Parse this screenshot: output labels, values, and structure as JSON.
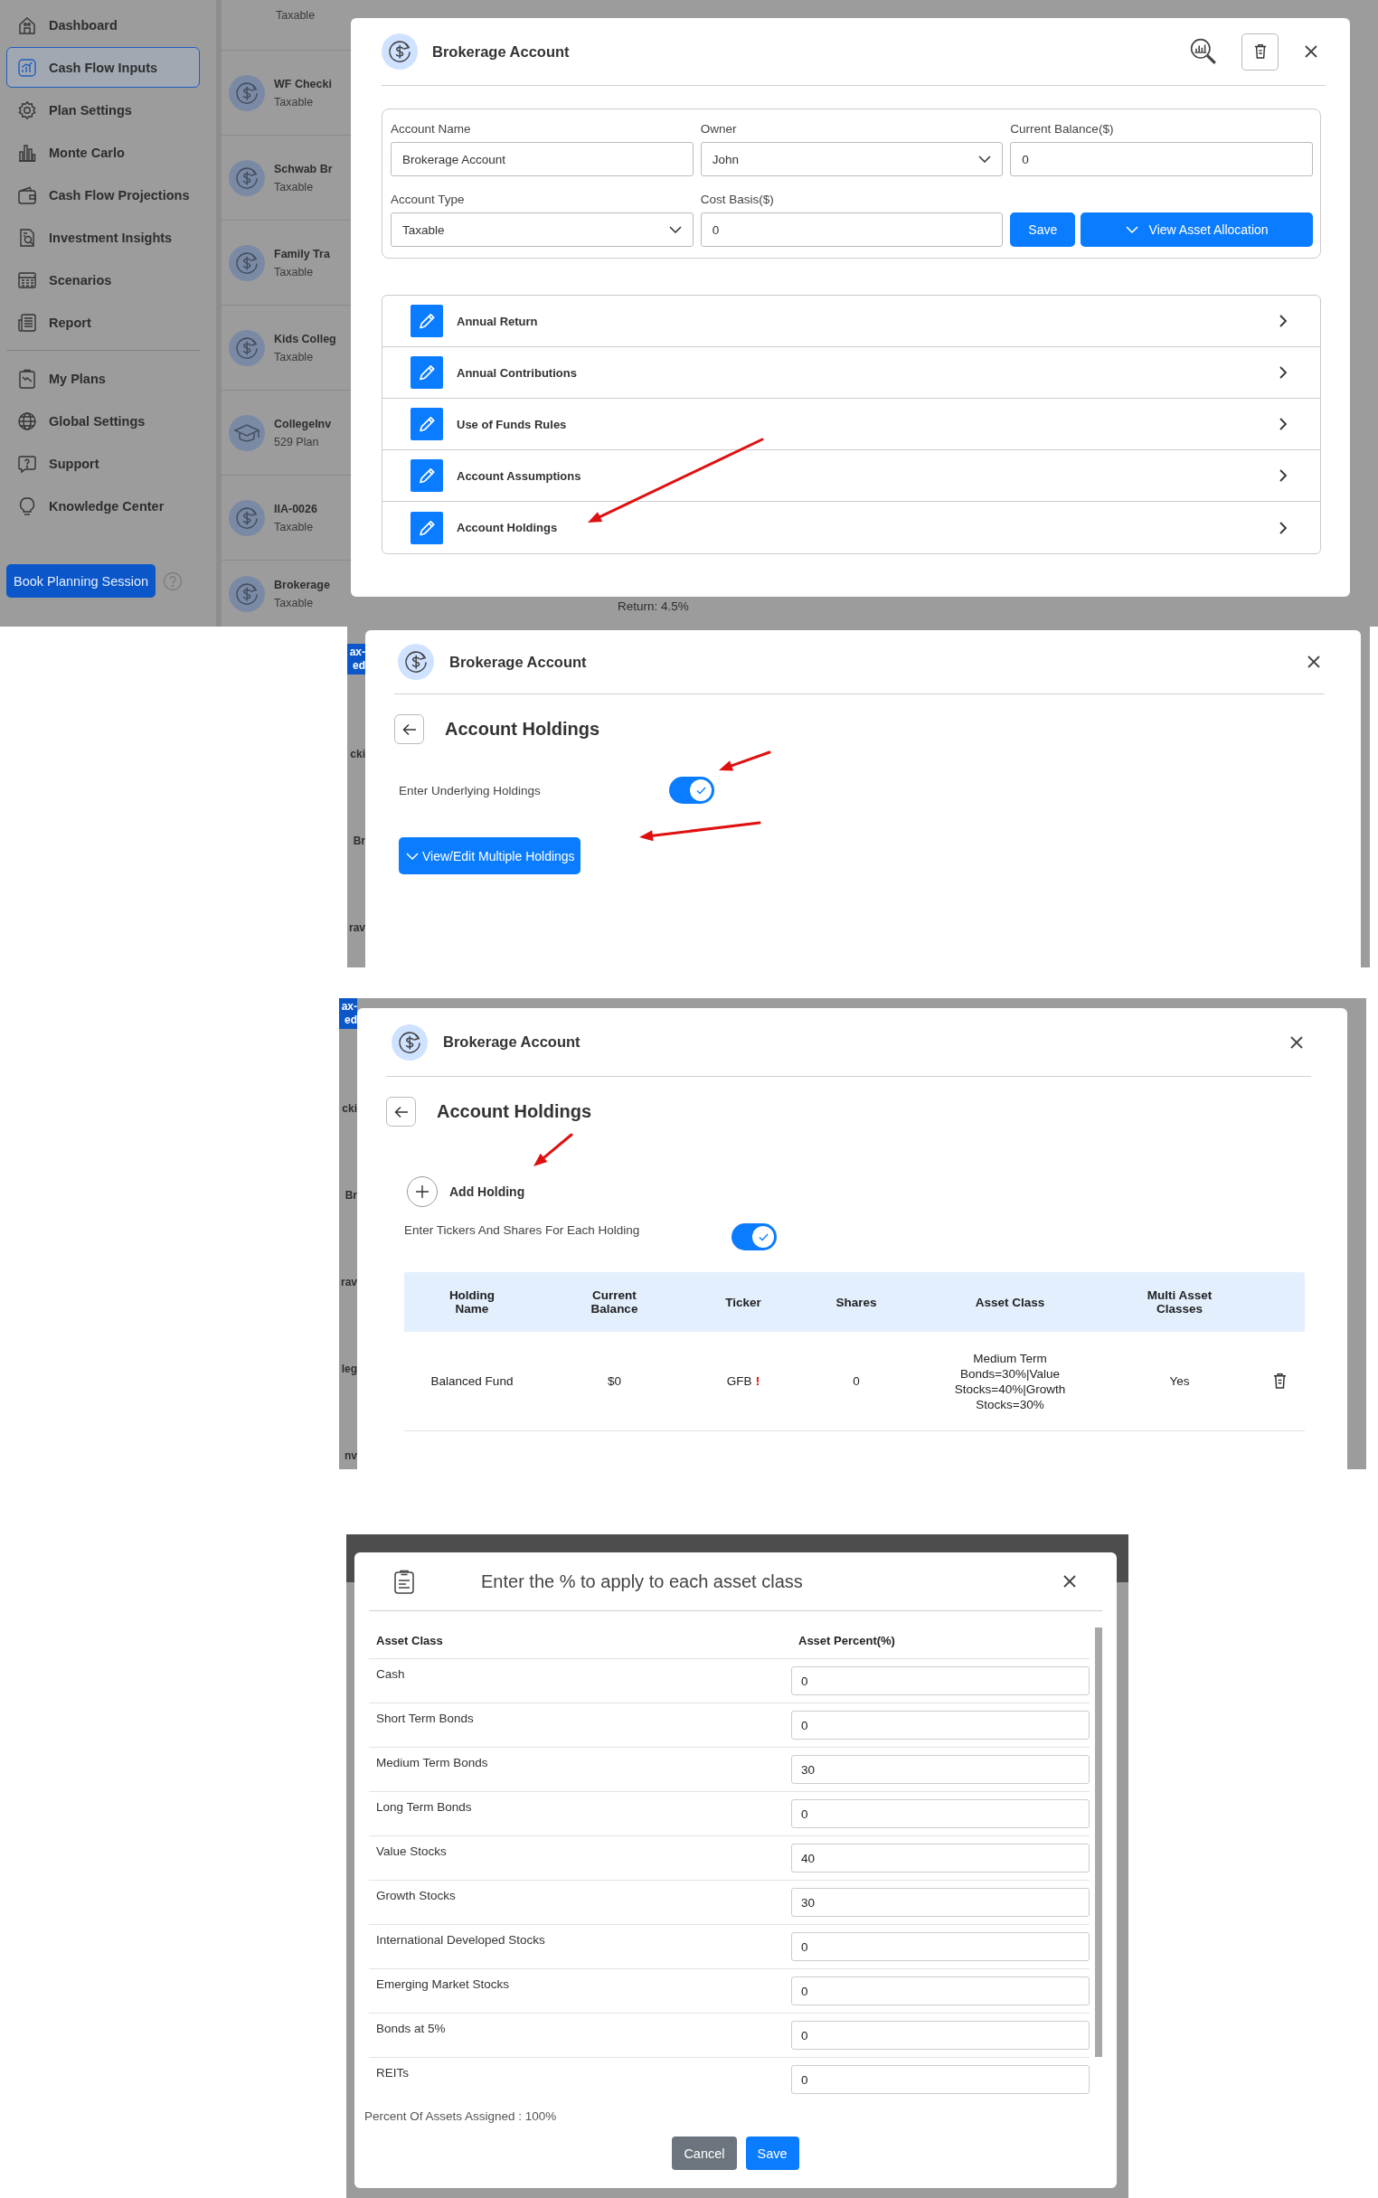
{
  "dashboard": {
    "sidebar": {
      "items": [
        {
          "label": "Dashboard",
          "selected": false
        },
        {
          "label": "Cash Flow Inputs",
          "selected": true
        },
        {
          "label": "Plan Settings",
          "selected": false
        },
        {
          "label": "Monte Carlo",
          "selected": false
        },
        {
          "label": "Cash Flow Projections",
          "selected": false
        },
        {
          "label": "Investment Insights",
          "selected": false
        },
        {
          "label": "Scenarios",
          "selected": false
        },
        {
          "label": "Report",
          "selected": false
        }
      ],
      "bottom_items": [
        {
          "label": "My Plans",
          "selected": false
        },
        {
          "label": "Global Settings",
          "selected": false
        },
        {
          "label": "Support",
          "selected": false
        },
        {
          "label": "Knowledge Center",
          "selected": false
        }
      ],
      "book_button": "Book Planning Session"
    },
    "accounts": [
      {
        "type": "Taxable"
      },
      {
        "kind": "dollar",
        "name": "WF Checki",
        "type": "Taxable"
      },
      {
        "kind": "dollar",
        "name": "Schwab Br",
        "type": "Taxable"
      },
      {
        "kind": "dollar",
        "name": "Family Tra",
        "type": "Taxable"
      },
      {
        "kind": "dollar",
        "name": "Kids Colleg",
        "type": "Taxable"
      },
      {
        "kind": "cap",
        "name": "CollegeInv",
        "type": "529 Plan"
      },
      {
        "kind": "dollar",
        "name": "IIA-0026",
        "type": "Taxable"
      },
      {
        "kind": "dollar",
        "name": "Brokerage",
        "type": "Taxable"
      }
    ],
    "return_text": "Return: 4.5%"
  },
  "account_modal": {
    "title": "Brokerage Account",
    "fields": [
      {
        "label": "Account Name",
        "kind": "text",
        "value": "Brokerage Account"
      },
      {
        "label": "Owner",
        "kind": "select",
        "value": "John"
      },
      {
        "label": "Current Balance($)",
        "kind": "text",
        "value": "0"
      },
      {
        "label": "Account Type",
        "kind": "select",
        "value": "Taxable"
      },
      {
        "label": "Cost Basis($)",
        "kind": "text",
        "value": "0"
      }
    ],
    "save_button": "Save",
    "allocation_button": "View Asset Allocation",
    "sections": [
      "Annual Return",
      "Annual Contributions",
      "Use of Funds Rules",
      "Account Assumptions",
      "Account Holdings"
    ]
  },
  "holdings_modal": {
    "side_fragments": [
      {
        "kind": "tag",
        "text": "ax-"
      },
      {
        "kind": "tag",
        "text": "ed"
      },
      {
        "kind": "plain",
        "text": "cki"
      },
      {
        "kind": "plain",
        "text": "Br"
      },
      {
        "kind": "plain",
        "text": "rav"
      }
    ],
    "title": "Brokerage Account",
    "heading": "Account Holdings",
    "toggle": {
      "label": "Enter Underlying Holdings",
      "on": true
    },
    "button": "View/Edit Multiple Holdings"
  },
  "holdings_table_modal": {
    "side_fragments": [
      {
        "kind": "tag",
        "text": "ax-"
      },
      {
        "kind": "tag",
        "text": "ed"
      },
      {
        "kind": "plain",
        "text": "cki"
      },
      {
        "kind": "plain",
        "text": "Br"
      },
      {
        "kind": "plain",
        "text": "rav"
      },
      {
        "kind": "plain",
        "text": "leg"
      },
      {
        "kind": "plain",
        "text": "nv"
      }
    ],
    "title": "Brokerage Account",
    "heading": "Account Holdings",
    "add_button": "Add Holding",
    "toggle": {
      "label": "Enter Tickers And Shares For Each Holding",
      "on": true
    },
    "table": {
      "columns": [
        "Holding Name",
        "Current Balance",
        "Ticker",
        "Shares",
        "Asset Class",
        "Multi Asset Classes"
      ],
      "rows": [
        {
          "holding_name": "Balanced Fund",
          "current_balance": "$0",
          "ticker": "GFB",
          "ticker_warning": "!",
          "shares": "0",
          "asset_class": "Medium Term Bonds=30%|Value Stocks=40%|Growth Stocks=30%",
          "multi_asset_classes": "Yes"
        }
      ]
    }
  },
  "asset_modal": {
    "title": "Enter the % to apply to each asset class",
    "columns": [
      "Asset Class",
      "Asset Percent(%)"
    ],
    "rows": [
      {
        "asset_class": "Cash",
        "percent": "0"
      },
      {
        "asset_class": "Short Term Bonds",
        "percent": "0"
      },
      {
        "asset_class": "Medium Term Bonds",
        "percent": "30"
      },
      {
        "asset_class": "Long Term Bonds",
        "percent": "0"
      },
      {
        "asset_class": "Value Stocks",
        "percent": "40"
      },
      {
        "asset_class": "Growth Stocks",
        "percent": "30"
      },
      {
        "asset_class": "International Developed Stocks",
        "percent": "0"
      },
      {
        "asset_class": "Emerging Market Stocks",
        "percent": "0"
      },
      {
        "asset_class": "Bonds at 5%",
        "percent": "0"
      },
      {
        "asset_class": "REITs",
        "percent": "0"
      }
    ],
    "summary": "Percent Of Assets Assigned : 100%",
    "cancel_button": "Cancel",
    "save_button": "Save"
  }
}
